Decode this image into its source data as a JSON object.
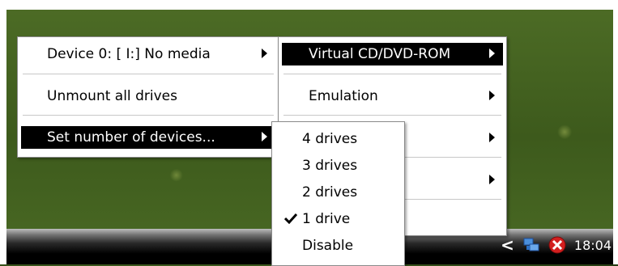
{
  "menu_primary": {
    "items": [
      {
        "label": "Device 0: [ I:] No media",
        "has_submenu": true,
        "selected": false
      },
      {
        "label": "Unmount all drives",
        "has_submenu": false,
        "selected": false
      },
      {
        "label": "Set number of devices...",
        "has_submenu": true,
        "selected": true
      }
    ]
  },
  "menu_device": {
    "items": [
      {
        "label": "Virtual CD/DVD-ROM",
        "has_submenu": true,
        "selected": true
      },
      {
        "label": "Emulation",
        "has_submenu": true,
        "selected": false
      }
    ]
  },
  "menu_count": {
    "items": [
      {
        "label": "4 drives",
        "checked": false
      },
      {
        "label": "3 drives",
        "checked": false
      },
      {
        "label": "2 drives",
        "checked": false
      },
      {
        "label": "1 drive",
        "checked": true
      },
      {
        "label": "Disable",
        "checked": false
      }
    ]
  },
  "taskbar": {
    "clock": "18:04",
    "tray_icons": [
      "chevron-left-icon",
      "network-icon",
      "daemon-tools-icon"
    ]
  },
  "colors": {
    "menu_selected_bg": "#000000",
    "menu_bg": "#ffffff",
    "desktop": "#3d5a1c"
  }
}
